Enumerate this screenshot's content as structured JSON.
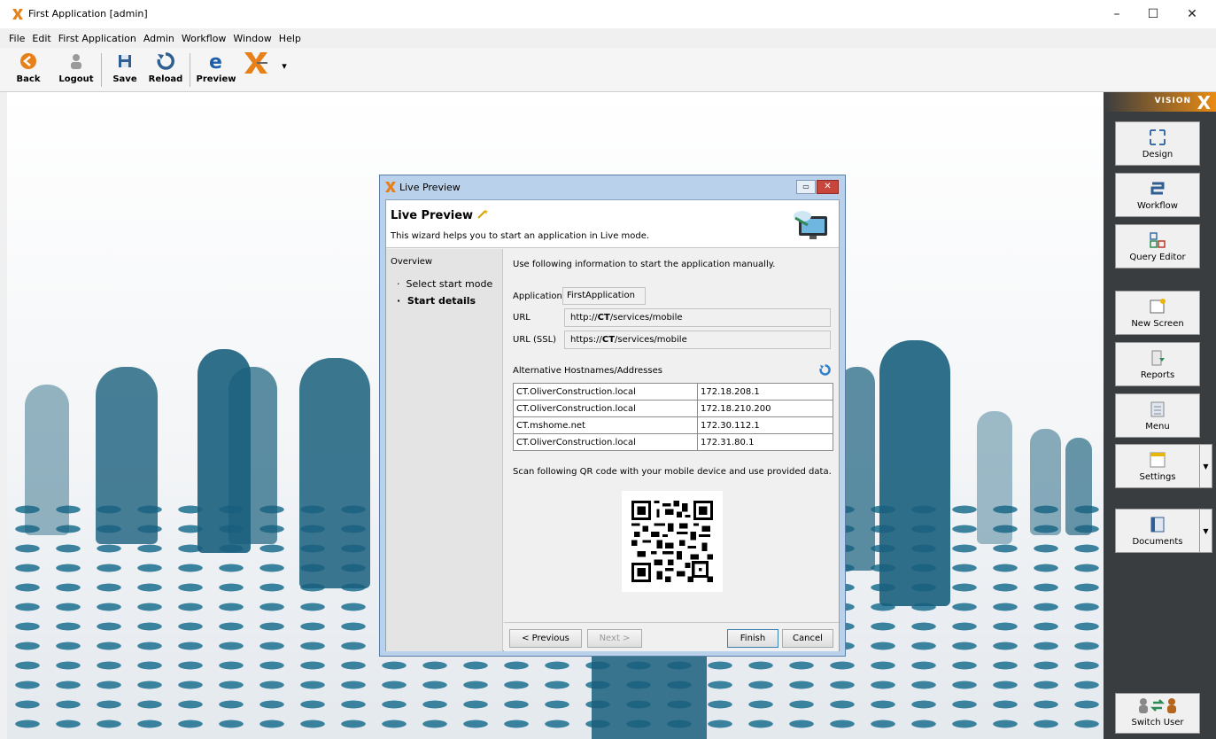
{
  "window": {
    "title": "First Application [admin]",
    "controls": [
      "–",
      "☐",
      "✕"
    ]
  },
  "menubar": {
    "items": [
      "File",
      "Edit",
      "First Application",
      "Admin",
      "Workflow",
      "Window",
      "Help"
    ]
  },
  "toolbar": {
    "buttons": [
      {
        "label": "Back",
        "icon": "back-arrow-icon"
      },
      {
        "label": "Logout",
        "icon": "logout-icon"
      },
      {
        "label": "Save",
        "icon": "save-icon"
      },
      {
        "label": "Reload",
        "icon": "reload-icon"
      },
      {
        "label": "Preview",
        "icon": "browser-preview-icon"
      }
    ],
    "extra_icon": "visionx-logo-icon",
    "dropdown": "▾"
  },
  "sidebar": {
    "brand": "VISION",
    "brand_x": "X",
    "buttons": [
      {
        "label": "Design",
        "icon": "design-icon"
      },
      {
        "label": "Workflow",
        "icon": "workflow-icon"
      },
      {
        "label": "Query Editor",
        "icon": "query-editor-icon"
      },
      {
        "label": "New Screen",
        "icon": "new-screen-icon"
      },
      {
        "label": "Reports",
        "icon": "reports-icon"
      },
      {
        "label": "Menu",
        "icon": "menu-icon"
      },
      {
        "label": "Settings",
        "icon": "settings-icon"
      },
      {
        "label": "Documents",
        "icon": "documents-icon"
      },
      {
        "label": "Switch User",
        "icon": "switch-user-icon"
      }
    ]
  },
  "dialog": {
    "window_title": "Live Preview",
    "header_title": "Live Preview",
    "header_desc": "This wizard helps you to start an application in Live mode.",
    "nav": {
      "overview": "Overview",
      "steps": [
        "Select start mode",
        "Start details"
      ],
      "bullet": "·"
    },
    "intro": "Use following information to start the application manually.",
    "application": {
      "label": "Application",
      "value": "FirstApplication"
    },
    "url": {
      "label": "URL",
      "prefix": "http://",
      "host": "CT",
      "suffix": "/services/mobile"
    },
    "url_ssl": {
      "label": "URL (SSL)",
      "prefix": "https://",
      "host": "CT",
      "suffix": "/services/mobile"
    },
    "alt_title": "Alternative Hostnames/Addresses",
    "alt_rows": [
      {
        "host": "CT.OliverConstruction.local",
        "ip": "172.18.208.1"
      },
      {
        "host": "CT.OliverConstruction.local",
        "ip": "172.18.210.200"
      },
      {
        "host": "CT.mshome.net",
        "ip": "172.30.112.1"
      },
      {
        "host": "CT.OliverConstruction.local",
        "ip": "172.31.80.1"
      }
    ],
    "qr_text": "Scan following QR code with your mobile device and use provided data.",
    "buttons": {
      "previous": "< Previous",
      "next": "Next >",
      "finish": "Finish",
      "cancel": "Cancel"
    }
  }
}
